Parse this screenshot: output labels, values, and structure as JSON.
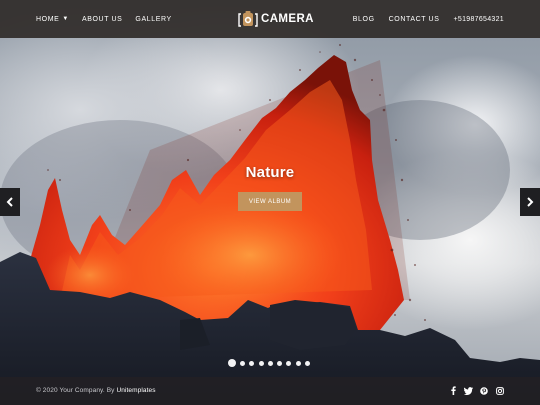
{
  "header": {
    "nav_left": [
      {
        "label": "HOME",
        "has_dropdown": true
      },
      {
        "label": "ABOUT US"
      },
      {
        "label": "GALLERY"
      }
    ],
    "logo_text": "CAMERA",
    "nav_right": [
      {
        "label": "BLOG"
      },
      {
        "label": "CONTACT US"
      }
    ],
    "phone": "+51987654321"
  },
  "slide": {
    "title": "Nature",
    "button_label": "VIEW ALBUM",
    "dot_count": 9,
    "active_dot_index": 0
  },
  "footer": {
    "copyright_prefix": "© 2020 Your Company. By ",
    "copyright_author": "Unitemplates",
    "social_icons": [
      "facebook-icon",
      "twitter-icon",
      "pinterest-icon",
      "instagram-icon"
    ]
  },
  "colors": {
    "accent_button": "#c2945d",
    "header_bg": "#302c2a",
    "footer_bg": "#222024"
  }
}
